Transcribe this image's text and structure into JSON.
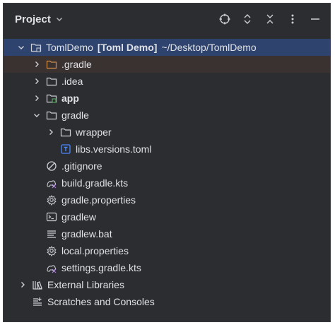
{
  "header": {
    "title": "Project",
    "icons": [
      "chevron-down-icon",
      "locate-icon",
      "expand-all-icon",
      "collapse-all-icon",
      "more-options-icon",
      "minimize-icon"
    ]
  },
  "tree": {
    "root": {
      "name": "TomlDemo",
      "module": "[Toml Demo]",
      "path": "~/Desktop/TomlDemo"
    },
    "items": {
      "gradle_dir": ".gradle",
      "idea": ".idea",
      "app": "app",
      "gradle": "gradle",
      "wrapper": "wrapper",
      "libs_versions": "libs.versions.toml",
      "gitignore": ".gitignore",
      "build_gradle": "build.gradle.kts",
      "gradle_properties": "gradle.properties",
      "gradlew": "gradlew",
      "gradlew_bat": "gradlew.bat",
      "local_properties": "local.properties",
      "settings_gradle": "settings.gradle.kts",
      "external_libraries": "External Libraries",
      "scratches": "Scratches and Consoles"
    }
  },
  "colors": {
    "panel_bg": "#2b2d30",
    "selected_row": "#2e436e",
    "excluded_folder": "#d18e4a",
    "text": "#dfe1e5",
    "toml_icon": "#4a88ff"
  }
}
